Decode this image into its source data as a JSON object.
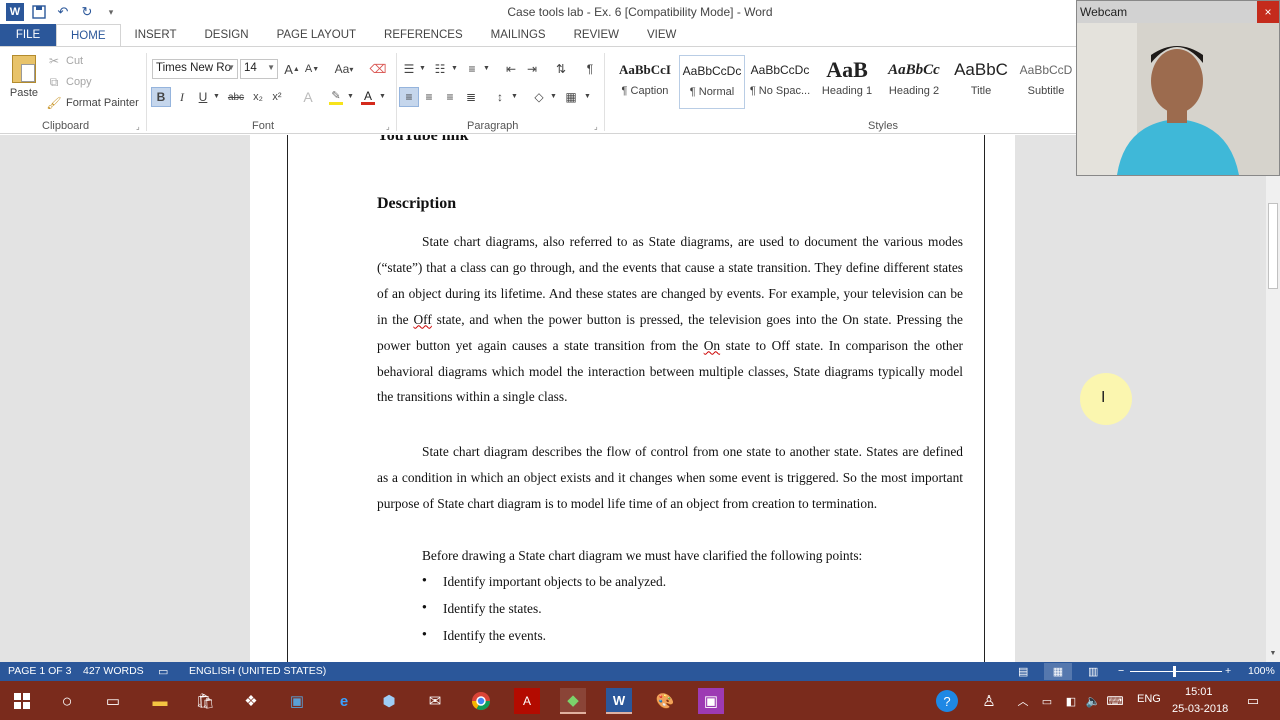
{
  "app": {
    "title": "Case tools lab - Ex. 6 [Compatibility Mode] - Word"
  },
  "quick_access": {
    "icons": [
      "word-icon",
      "save-icon",
      "undo-icon",
      "redo-icon",
      "customize-icon"
    ]
  },
  "tabs": [
    "FILE",
    "HOME",
    "INSERT",
    "DESIGN",
    "PAGE LAYOUT",
    "REFERENCES",
    "MAILINGS",
    "REVIEW",
    "VIEW"
  ],
  "active_tab": "HOME",
  "clipboard": {
    "paste": "Paste",
    "cut": "Cut",
    "copy": "Copy",
    "format_painter": "Format Painter",
    "label": "Clipboard"
  },
  "font": {
    "name": "Times New Ro",
    "size": "14",
    "label": "Font",
    "bold": "B",
    "italic": "I",
    "underline": "U",
    "strike": "abc",
    "sub": "x₂",
    "sup": "x²",
    "grow": "A",
    "shrink": "A",
    "case": "Aa",
    "effects": "A",
    "highlight_color": "#f7e31b",
    "font_color": "#d42a1c"
  },
  "paragraph": {
    "label": "Paragraph"
  },
  "styles": {
    "label": "Styles",
    "items": [
      {
        "sample": "AaBbCcI",
        "name": "¶ Caption"
      },
      {
        "sample": "AaBbCcDc",
        "name": "¶ Normal"
      },
      {
        "sample": "AaBbCcDc",
        "name": "¶ No Spac..."
      },
      {
        "sample": "AaB",
        "name": "Heading 1"
      },
      {
        "sample": "AaBbCc",
        "name": "Heading 2"
      },
      {
        "sample": "AaBbC",
        "name": "Title"
      },
      {
        "sample": "AaBbCcD",
        "name": "Subtitle"
      }
    ]
  },
  "document": {
    "heading_youtube": "YouTube link",
    "heading_description": "Description",
    "para1_parts": [
      "State chart diagrams, also referred to as State diagrams, are used to document the various modes (“state”) that a class can go through, and the events that cause a state transition. They define different states of an object during its lifetime. And these states are changed by events. For example, your television can be in the ",
      "Off",
      " state, and when the power button is pressed, the television goes into the On state. Pressing the power button yet again causes a state transition from the ",
      "On",
      " state to Off state. In comparison the other behavioral diagrams which model the interaction between multiple classes, State diagrams typically model the transitions within a single class."
    ],
    "para2": "State chart diagram describes the flow of control from one state to another state. States are defined as a condition in which an object exists and it changes when some event is triggered. So the most important purpose of State chart diagram is to model life time of an object from creation to termination.",
    "para3": "Before drawing a State chart diagram we must have clarified the following points:",
    "bullets": [
      "Identify important objects to be analyzed.",
      "Identify the states.",
      "Identify the events."
    ]
  },
  "status": {
    "page": "PAGE 1 OF 3",
    "words": "427 WORDS",
    "language": "ENGLISH (UNITED STATES)",
    "zoom": "100%",
    "zoom_minus": "−",
    "zoom_plus": "+"
  },
  "webcam": {
    "title": "Webcam",
    "close": "×"
  },
  "taskbar": {
    "lang": "ENG",
    "time": "15:01",
    "date": "25-03-2018"
  },
  "colors": {
    "word_blue": "#2b579a",
    "taskbar": "#7a2b1c"
  }
}
